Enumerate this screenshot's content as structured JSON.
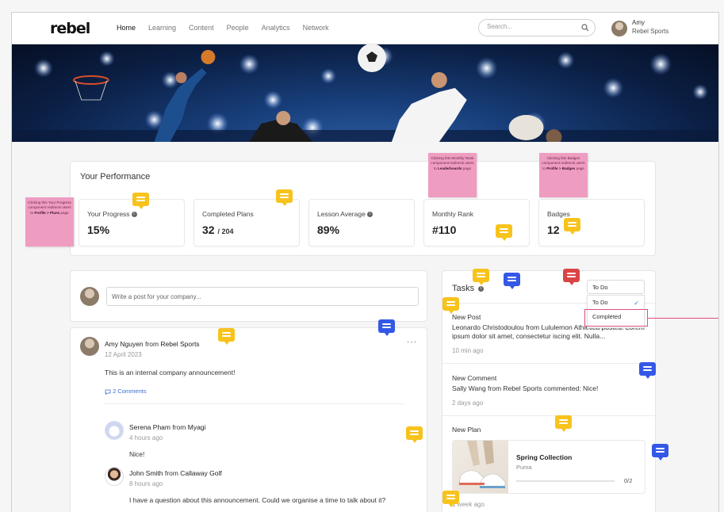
{
  "header": {
    "logo": "rebel",
    "nav": [
      "Home",
      "Learning",
      "Content",
      "People",
      "Analytics",
      "Network"
    ],
    "search_placeholder": "Search...",
    "user_name": "Amy",
    "user_company": "Rebel Sports"
  },
  "performance": {
    "title": "Your Performance",
    "stats": [
      {
        "label": "Your Progress",
        "value": "15%"
      },
      {
        "label": "Completed Plans",
        "value": "32",
        "suffix": "/ 204"
      },
      {
        "label": "Lesson Average",
        "value": "89%"
      },
      {
        "label": "Monthly Rank",
        "value": "#110"
      },
      {
        "label": "Badges",
        "value": "12"
      }
    ]
  },
  "composer": {
    "placeholder": "Write a post for your company..."
  },
  "post": {
    "author": "Amy Nguyen",
    "from": "from",
    "company": "Rebel Sports",
    "date": "12 April 2023",
    "body": "This is an internal company announcement!",
    "comments_link": "2 Comments",
    "more": "···",
    "comments": [
      {
        "author": "Serena Pham",
        "from": "from",
        "company": "Myagi",
        "time": "4 hours ago",
        "text": "Nice!"
      },
      {
        "author": "John Smith",
        "from": "from",
        "company": "Callaway Golf",
        "time": "8 hours ago",
        "text": "I have a question about this announcement. Could we organise a time to talk about it?"
      }
    ]
  },
  "tasks": {
    "title": "Tasks",
    "filter_selected": "To Do",
    "filter_options": [
      "To Do",
      "Completed"
    ],
    "items": [
      {
        "type": "New Post",
        "text": "Leonardo Christodoulou from Lululemon Athletica posted: Lorem ipsum dolor sit amet, consectetur iscing elit. Nulla...",
        "ago": "10 min ago"
      },
      {
        "type": "New Comment",
        "text": "Sally Wang from Rebel Sports commented: Nice!",
        "ago": "2 days ago"
      },
      {
        "type": "New Plan",
        "ago": "1 week ago"
      }
    ],
    "plan": {
      "name": "Spring Collection",
      "brand": "Puma",
      "progress": "0/2",
      "progress_fraction": 0.0
    }
  },
  "annotations": {
    "progress_note": {
      "text": "Clicking this Your Progress component redirects users to",
      "bold": "Profile > Plans",
      "tail": "page"
    },
    "rank_note": {
      "text": "Clicking this Monthly Rank component redirects users to",
      "bold": "Leaderboards",
      "tail": "page"
    },
    "badges_note": {
      "text": "Clicking this Badges component redirects users to",
      "bold": "Profile > Badges",
      "tail": "page"
    }
  },
  "colors": {
    "sticky": "#ef9cc1",
    "badge_yellow": "#f7c31c",
    "badge_blue": "#3458e6",
    "badge_red": "#d94545",
    "link": "#3b6fd4",
    "highlight": "#e0507a"
  }
}
